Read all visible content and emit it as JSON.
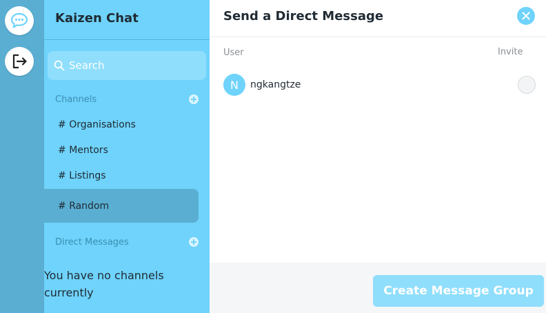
{
  "app": {
    "title": "Kaizen Chat"
  },
  "rail": {
    "icons": [
      "chat-bubble-icon",
      "logout-icon"
    ]
  },
  "sidebar": {
    "search": {
      "placeholder": "Search"
    },
    "channels_label": "Channels",
    "channels": [
      {
        "label": "Organisations",
        "active": false
      },
      {
        "label": "Mentors",
        "active": false
      },
      {
        "label": "Listings",
        "active": false
      },
      {
        "label": "Random",
        "active": true
      }
    ],
    "dm_label": "Direct Messages",
    "empty_text": "You have no channels currently"
  },
  "dialog": {
    "title": "Send a Direct Message",
    "columns": {
      "user": "User",
      "invite": "Invite"
    },
    "users": [
      {
        "initial": "N",
        "name": "ngkangtze",
        "invited": false
      }
    ],
    "create_button": "Create Message Group"
  },
  "colors": {
    "accent": "#6fd3fb",
    "rail": "#5aaed2",
    "active_channel": "#5aaed2",
    "button_disabled": "#8fdefc"
  }
}
